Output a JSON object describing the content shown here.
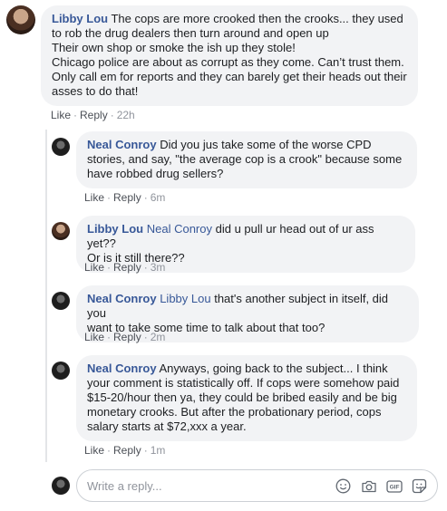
{
  "comment": {
    "author": "Libby Lou",
    "text": " The cops are more crooked then the crooks... they used\nto rob the drug dealers then turn around and open up\nTheir own shop or smoke the ish up they stole!\nChicago police are about as corrupt as they come. Can’t trust them.\nOnly call em for reports and they can barely get their heads out their\nasses to do that!",
    "like_label": "Like",
    "reply_label": "Reply",
    "time": "22h"
  },
  "replies": [
    {
      "author": "Neal Conroy",
      "mention": "",
      "text": " Did you jus take some of the worse CPD\nstories, and say, \"the average cop is a crook\" because some\nhave robbed drug sellers?",
      "like_label": "Like",
      "reply_label": "Reply",
      "time": "6m"
    },
    {
      "author": "Libby Lou",
      "mention": "Neal Conroy",
      "text": " did u pull ur head out of ur ass yet??\nOr is it still there??",
      "like_label": "Like",
      "reply_label": "Reply",
      "time": "3m"
    },
    {
      "author": "Neal Conroy",
      "mention": "Libby Lou",
      "text": " that's another subject in itself, did you\nwant to take some time to talk about that too?",
      "like_label": "Like",
      "reply_label": "Reply",
      "time": "2m"
    },
    {
      "author": "Neal Conroy",
      "mention": "",
      "text": " Anyways, going back to the subject... I think\nyour comment is statistically off. If cops were somehow paid\n$15-20/hour then ya, they could be bribed easily and be big\nmonetary crooks. But after the probationary period, cops\nsalary starts at $72,xxx a year.",
      "like_label": "Like",
      "reply_label": "Reply",
      "time": "1m"
    }
  ],
  "reply_box": {
    "placeholder": "Write a reply...",
    "icons": [
      "emoji-icon",
      "camera-icon",
      "gif-icon",
      "sticker-icon"
    ]
  }
}
